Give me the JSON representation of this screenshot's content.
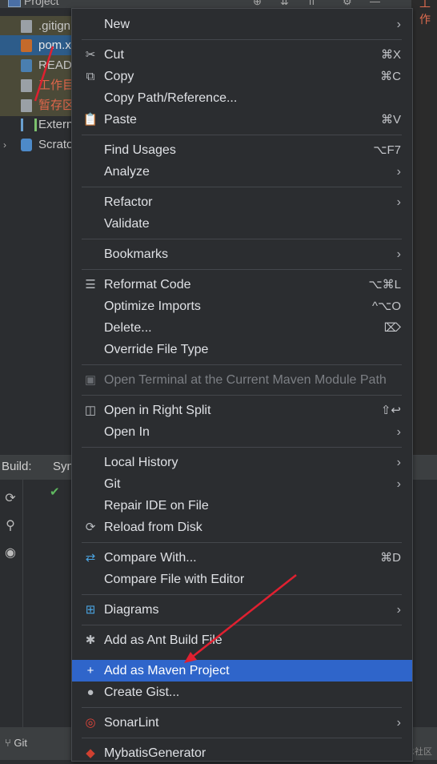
{
  "topbar": {
    "project_label": "Project"
  },
  "editor": {
    "tab_label": "工作"
  },
  "tree": [
    {
      "label": ".gitign",
      "icon": "gitignore-file-icon"
    },
    {
      "label": "pom.x",
      "icon": "xml-file-icon"
    },
    {
      "label": "READ",
      "icon": "markdown-file-icon"
    },
    {
      "label": "工作目",
      "icon": "text-file-icon"
    },
    {
      "label": "暂存区",
      "icon": "text-file-icon"
    },
    {
      "label": "Extern",
      "icon": "external-libraries-icon"
    },
    {
      "label": "Scrato",
      "icon": "scratches-icon"
    }
  ],
  "bottom_panel": {
    "build_label": "Build:",
    "sync_label": "Syn"
  },
  "status": {
    "git_label": "Git",
    "watermark": "@稀土掘金技术社区"
  },
  "menu": {
    "new": "New",
    "cut": "Cut",
    "cut_sc": "⌘X",
    "copy": "Copy",
    "copy_sc": "⌘C",
    "copy_path": "Copy Path/Reference...",
    "paste": "Paste",
    "paste_sc": "⌘V",
    "find_usages": "Find Usages",
    "find_usages_sc": "⌥F7",
    "analyze": "Analyze",
    "refactor": "Refactor",
    "validate": "Validate",
    "bookmarks": "Bookmarks",
    "reformat": "Reformat Code",
    "reformat_sc": "⌥⌘L",
    "optimize": "Optimize Imports",
    "optimize_sc": "^⌥O",
    "delete": "Delete...",
    "delete_sc": "⌦",
    "override": "Override File Type",
    "open_terminal": "Open Terminal at the Current Maven Module Path",
    "open_right": "Open in Right Split",
    "open_right_sc": "⇧↩",
    "open_in": "Open In",
    "local_history": "Local History",
    "git": "Git",
    "repair": "Repair IDE on File",
    "reload": "Reload from Disk",
    "compare_with": "Compare With...",
    "compare_with_sc": "⌘D",
    "compare_editor": "Compare File with Editor",
    "diagrams": "Diagrams",
    "add_ant": "Add as Ant Build File",
    "add_maven": "Add as Maven Project",
    "create_gist": "Create Gist...",
    "sonarlint": "SonarLint",
    "mybatis": "MybatisGenerator"
  }
}
